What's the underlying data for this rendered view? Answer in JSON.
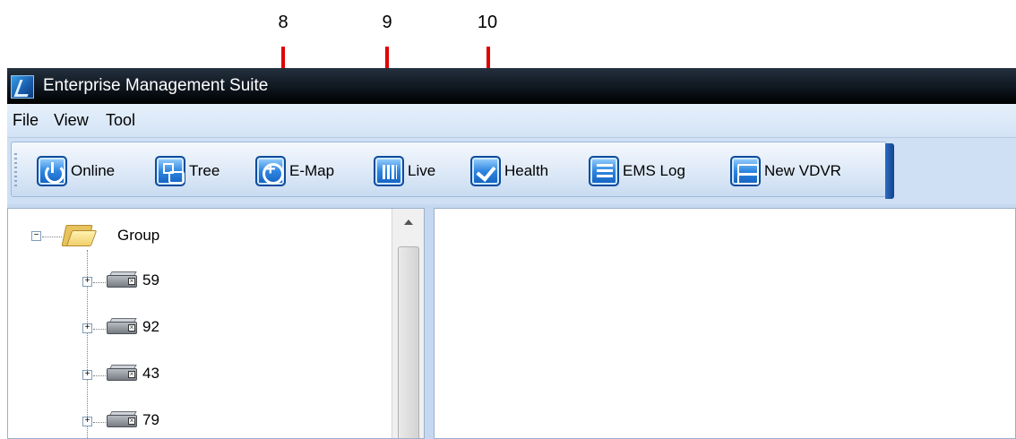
{
  "callouts": [
    {
      "number": "8"
    },
    {
      "number": "9"
    },
    {
      "number": "10"
    }
  ],
  "window": {
    "title": "Enterprise Management Suite",
    "app_icon": "app-logo-icon"
  },
  "menubar": {
    "items": [
      "File",
      "View",
      "Tool"
    ]
  },
  "toolbar": {
    "buttons": [
      {
        "label": "Online",
        "icon": "power-icon"
      },
      {
        "label": "Tree",
        "icon": "tree-icon"
      },
      {
        "label": "E-Map",
        "icon": "target-icon"
      },
      {
        "label": "Live",
        "icon": "bars-icon"
      },
      {
        "label": "Health",
        "icon": "checkmark-icon"
      },
      {
        "label": "EMS Log",
        "icon": "list-icon"
      },
      {
        "label": "New VDVR",
        "icon": "vdvr-icon"
      }
    ]
  },
  "tree": {
    "root": {
      "label": "Group",
      "expander": "−"
    },
    "children": [
      {
        "label": "59",
        "expander": "+"
      },
      {
        "label": "92",
        "expander": "+"
      },
      {
        "label": "43",
        "expander": "+"
      },
      {
        "label": "79",
        "expander": "+"
      }
    ]
  },
  "colors": {
    "callout_arrow": "#e00000",
    "titlebar": "#0d141c",
    "menubar": "#dbe8f7",
    "toolbar": "#dde9f7"
  }
}
